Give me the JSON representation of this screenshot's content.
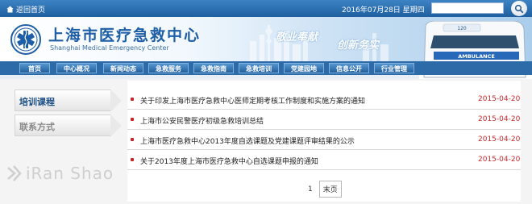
{
  "topbar": {
    "home_label": "返回首页",
    "date_text": "2016年07月28日 星期四",
    "search_placeholder": ""
  },
  "banner": {
    "cn_name": "上海市医疗急救中心",
    "en_name": "Shanghai Medical Emergency Center",
    "slogan_left": "敬业奉献",
    "slogan_right": "创新务实",
    "vehicle_number": "120",
    "vehicle_text": "AMBULANCE"
  },
  "nav": {
    "items": [
      {
        "label": "首页"
      },
      {
        "label": "中心概况"
      },
      {
        "label": "新闻动态"
      },
      {
        "label": "急救服务"
      },
      {
        "label": "急救指南"
      },
      {
        "label": "急救培训"
      },
      {
        "label": "党建园地"
      },
      {
        "label": "信息公开"
      },
      {
        "label": "行业管理"
      }
    ]
  },
  "sidebar": {
    "items": [
      {
        "label": "培训课程",
        "active": true
      },
      {
        "label": "联系方式",
        "active": false
      }
    ]
  },
  "news": {
    "items": [
      {
        "title": "关于印发上海市医疗急救中心医师定期考核工作制度和实施方案的通知",
        "date": "2015-04-20"
      },
      {
        "title": "上海市公安民警医疗初级急救培训总结",
        "date": "2015-04-20"
      },
      {
        "title": "上海市医疗急救中心2013年度自选课题及党建课题评审结果的公示",
        "date": "2015-04-20"
      },
      {
        "title": "关于2013年度上海市医疗急救中心自选课题申报的通知",
        "date": "2015-04-20"
      }
    ]
  },
  "pager": {
    "current": "1",
    "last_label": "末页"
  },
  "watermark": "iRan Shao",
  "colors": {
    "brand_blue": "#1d5ea6",
    "nav_blue": "#2c6ba7",
    "date_red": "#c9282d"
  }
}
